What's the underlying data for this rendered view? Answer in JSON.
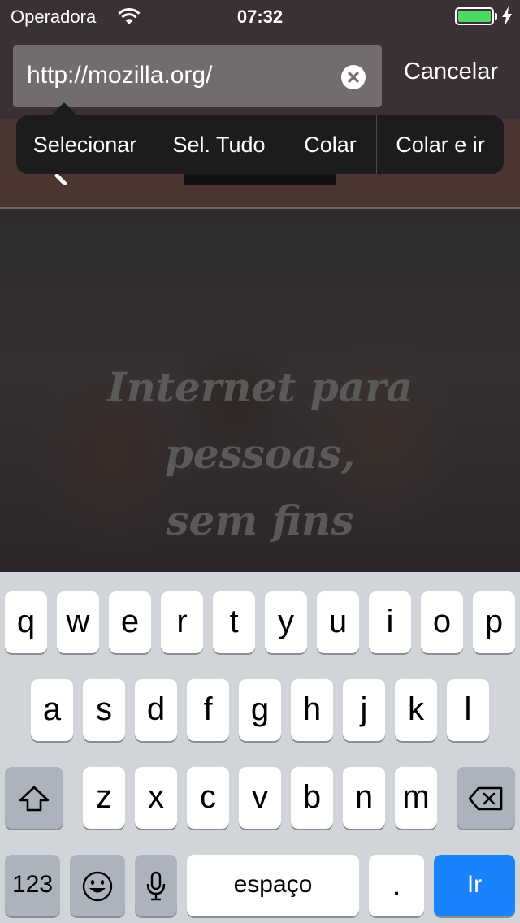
{
  "status_bar": {
    "carrier": "Operadora",
    "time": "07:32",
    "battery_level": 1.0,
    "battery_color": "#4cd964"
  },
  "url_bar": {
    "url": "http://mozilla.org/",
    "clear_icon": "clear-circle-x-icon",
    "cancel_label": "Cancelar"
  },
  "edit_menu": {
    "items": [
      "Selecionar",
      "Sel. Tudo",
      "Colar",
      "Colar e ir"
    ]
  },
  "page": {
    "hero_lines": [
      "Internet para",
      "pessoas,",
      "sem fins"
    ]
  },
  "keyboard": {
    "row1": [
      "q",
      "w",
      "e",
      "r",
      "t",
      "y",
      "u",
      "i",
      "o",
      "p"
    ],
    "row2": [
      "a",
      "s",
      "d",
      "f",
      "g",
      "h",
      "j",
      "k",
      "l"
    ],
    "row3": [
      "z",
      "x",
      "c",
      "v",
      "b",
      "n",
      "m"
    ],
    "shift_icon": "shift-arrow-icon",
    "backspace_icon": "backspace-icon",
    "numbers_label": "123",
    "emoji_icon": "emoji-icon",
    "mic_icon": "microphone-icon",
    "space_label": "espaço",
    "period_label": ".",
    "go_label": "Ir",
    "go_color": "#1a82fb"
  }
}
